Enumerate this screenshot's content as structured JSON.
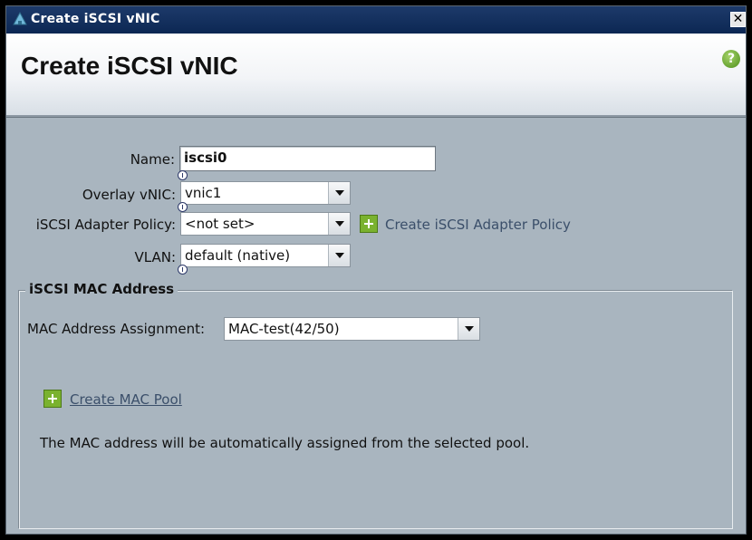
{
  "window": {
    "title": "Create iSCSI vNIC",
    "close_label": "✕"
  },
  "header": {
    "title": "Create iSCSI vNIC",
    "help_label": "?"
  },
  "form": {
    "name": {
      "label": "Name:",
      "value": "iscsi0"
    },
    "overlay_vnic": {
      "label": "Overlay vNIC:",
      "value": "vnic1"
    },
    "adapter_policy": {
      "label": "iSCSI Adapter Policy:",
      "value": "<not set>",
      "create_link": "Create iSCSI Adapter Policy"
    },
    "vlan": {
      "label": "VLAN:",
      "value": "default (native)"
    }
  },
  "mac_section": {
    "legend": "iSCSI MAC Address",
    "assignment_label": "MAC Address Assignment:",
    "assignment_value": "MAC-test(42/50)",
    "create_pool_link": "Create MAC Pool",
    "description": "The MAC address will be automatically assigned from the selected pool."
  },
  "colors": {
    "title_bar": "#0c2753",
    "panel_bg": "#a9b5bf",
    "accent_green": "#7ab22f"
  }
}
